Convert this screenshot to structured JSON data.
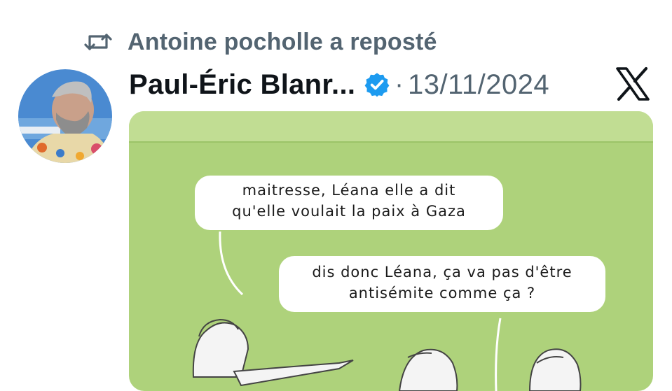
{
  "repost": {
    "icon": "repost-icon",
    "text": "Antoine pocholle a reposté"
  },
  "post": {
    "display_name": "Paul-Éric Blanr...",
    "verified_icon": "verified-badge-icon",
    "separator": "·",
    "date": "13/11/2024",
    "platform_icon": "x-logo-icon",
    "avatar": "avatar"
  },
  "media": {
    "bubble1": [
      "maitresse, Léana elle a dit",
      "qu'elle voulait la paix à Gaza"
    ],
    "bubble2": [
      "dis donc Léana, ça va pas d'être",
      "antisémite comme ça ?"
    ],
    "background_color": "#aed27b"
  },
  "colors": {
    "text_primary": "#0f1419",
    "text_secondary": "#536471",
    "verified": "#1d9bf0"
  }
}
